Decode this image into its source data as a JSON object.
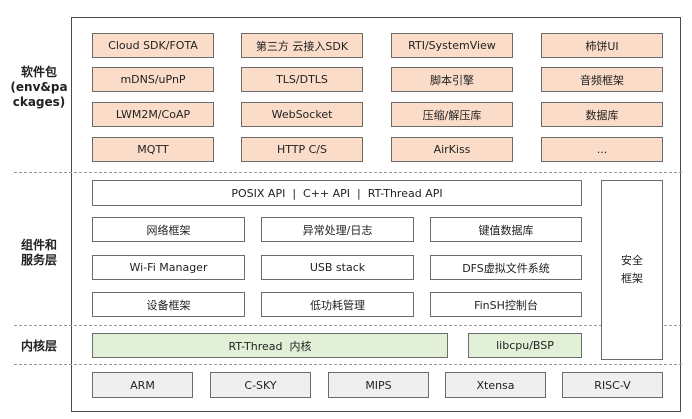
{
  "layers": {
    "software_packages": "软件包\n(env&pa\nckages)",
    "components": "组件和\n服务层",
    "kernel": "内核层"
  },
  "software_packages": [
    [
      "Cloud SDK/FOTA",
      "第三方 云接入SDK",
      "RTI/SystemView",
      "柿饼UI"
    ],
    [
      "mDNS/uPnP",
      "TLS/DTLS",
      "脚本引擎",
      "音频框架"
    ],
    [
      "LWM2M/CoAP",
      "WebSocket",
      "压缩/解压库",
      "数据库"
    ],
    [
      "MQTT",
      "HTTP C/S",
      "AirKiss",
      "..."
    ]
  ],
  "components": {
    "api_bar": "POSIX API  |  C++ API  |  RT-Thread API",
    "rows": [
      [
        "网络框架",
        "异常处理/日志",
        "键值数据库"
      ],
      [
        "Wi-Fi Manager",
        "USB stack",
        "DFS虚拟文件系统"
      ],
      [
        "设备框架",
        "低功耗管理",
        "FinSH控制台"
      ]
    ],
    "security": "安全\n框架"
  },
  "kernel": {
    "core": "RT-Thread  内核",
    "bsp": "libcpu/BSP"
  },
  "architectures": [
    "ARM",
    "C-SKY",
    "MIPS",
    "Xtensa",
    "RISC-V"
  ],
  "colors": {
    "package_fill": "#fbdcc8",
    "kernel_fill": "#e2f0d7",
    "arch_fill": "#efefef"
  }
}
